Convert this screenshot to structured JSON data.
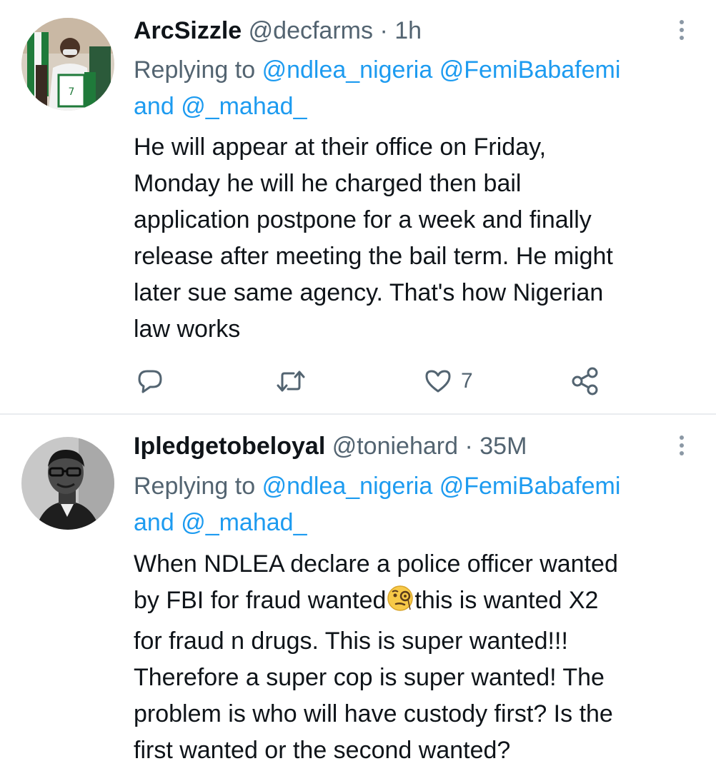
{
  "tweets": [
    {
      "name": "ArcSizzle",
      "handle": "@decfarms",
      "dot": "·",
      "time": "1h",
      "reply_prefix": "Replying to",
      "mention1": "@ndlea_nigeria",
      "mention2": "@FemiBabafemi",
      "reply_and": "and",
      "mention3": "@_mahad_",
      "text_lines": [
        "He will appear at their office on Friday,",
        "Monday he will he charged then bail",
        "application postpone for a week and finally",
        "release after meeting the bail term. He might",
        "later sue same agency. That's how Nigerian",
        "law works"
      ],
      "likes": "7"
    },
    {
      "name": "Ipledgetobeloyal",
      "handle": "@toniehard",
      "dot": "·",
      "time": "35M",
      "reply_prefix": "Replying to",
      "mention1": "@ndlea_nigeria",
      "mention2": "@FemiBabafemi",
      "reply_and": "and",
      "mention3": "@_mahad_",
      "text_line1": "When NDLEA declare a police officer wanted",
      "text_line2_a": "by FBI for fraud wanted",
      "text_line2_b": "this is wanted X2",
      "text_lines_rest": [
        "for fraud n drugs. This is super wanted!!!",
        "Therefore a super cop is super wanted! The",
        "problem is who will have custody first? Is the",
        "first wanted or the second wanted?"
      ]
    }
  ],
  "icons": {
    "reply": "reply-icon",
    "retweet": "retweet-icon",
    "like": "heart-icon",
    "share": "share-icon",
    "more": "more-vertical-icon",
    "emoji": "face-with-monocle-emoji"
  },
  "colors": {
    "text": "#0f1419",
    "secondary": "#536471",
    "link": "#1d9bf0",
    "divider": "#e9ecef"
  }
}
